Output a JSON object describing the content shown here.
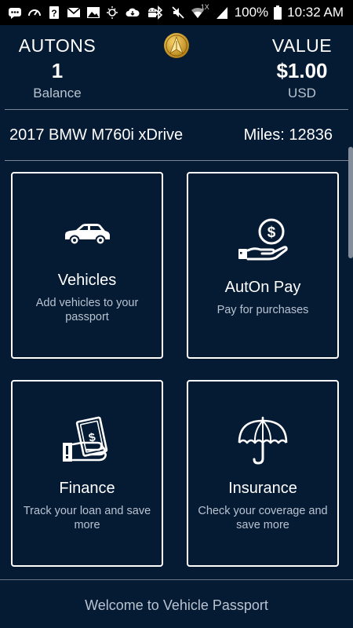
{
  "status_bar": {
    "battery": "100%",
    "time": "10:32 AM",
    "speed_indicator": "1X",
    "icons_left": [
      "messages-icon",
      "speedometer-icon",
      "help-icon",
      "gmail-icon",
      "photo-icon",
      "weather-icon",
      "cloud-icon",
      "android-icon"
    ],
    "icons_right": [
      "bluetooth-icon",
      "mute-icon",
      "wifi-icon",
      "signal-icon",
      "battery-icon"
    ]
  },
  "header": {
    "left": {
      "title": "AUTONS",
      "value": "1",
      "unit": "Balance"
    },
    "right": {
      "title": "VALUE",
      "value": "$1.00",
      "unit": "USD"
    },
    "logo_icon": "auton-coin-logo-icon"
  },
  "vehicle": {
    "name": "2017 BMW M760i xDrive",
    "miles": "Miles: 12836"
  },
  "tiles": [
    {
      "title": "Vehicles",
      "description": "Add vehicles to your passport",
      "icon": "car-icon"
    },
    {
      "title": "AutOn Pay",
      "description": "Pay for purchases",
      "icon": "coin-hand-icon"
    },
    {
      "title": "Finance",
      "description": "Track your loan and save more",
      "icon": "cash-hand-icon"
    },
    {
      "title": "Insurance",
      "description": "Check your coverage and save more",
      "icon": "umbrella-icon"
    }
  ],
  "footer": {
    "text": "Welcome to Vehicle Passport"
  },
  "colors": {
    "background": "#051a33",
    "accent_gold": "#d4a52a",
    "muted_text": "#b8c3d0"
  }
}
